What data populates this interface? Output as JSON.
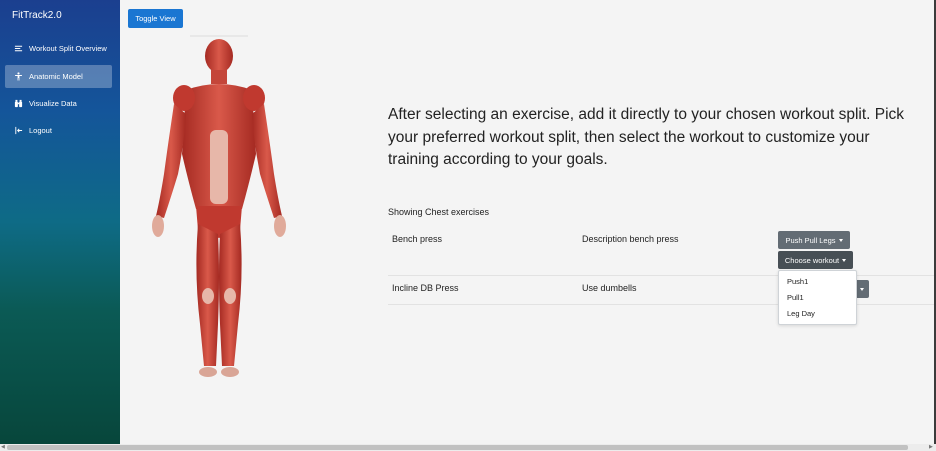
{
  "app": {
    "brand": "FitTrack2.0"
  },
  "sidebar": {
    "items": [
      {
        "label": "Workout Split Overview",
        "icon": "list-icon",
        "active": false
      },
      {
        "label": "Anatomic Model",
        "icon": "person-icon",
        "active": true
      },
      {
        "label": "Visualize Data",
        "icon": "binoculars-icon",
        "active": false
      },
      {
        "label": "Logout",
        "icon": "logout-icon",
        "active": false
      }
    ]
  },
  "main": {
    "toggle_label": "Toggle View",
    "intro": "After selecting an exercise, add it directly to your chosen workout split. Pick your preferred workout split, then select the workout to customize your training according to your goals.",
    "showing": "Showing Chest exercises",
    "exercises": [
      {
        "name": "Bench press",
        "description": "Description bench press",
        "split_label": "Push Pull Legs",
        "workout_label": "Choose workout"
      },
      {
        "name": "Incline DB Press",
        "description": "Use dumbells"
      }
    ],
    "workout_menu": [
      "Push1",
      "Pull1",
      "Leg Day"
    ]
  },
  "colors": {
    "primary_button": "#1a76d2",
    "secondary_button": "#636c74",
    "sidebar_gradient_top": "#1b3f8f",
    "sidebar_gradient_bottom": "#07463b"
  }
}
